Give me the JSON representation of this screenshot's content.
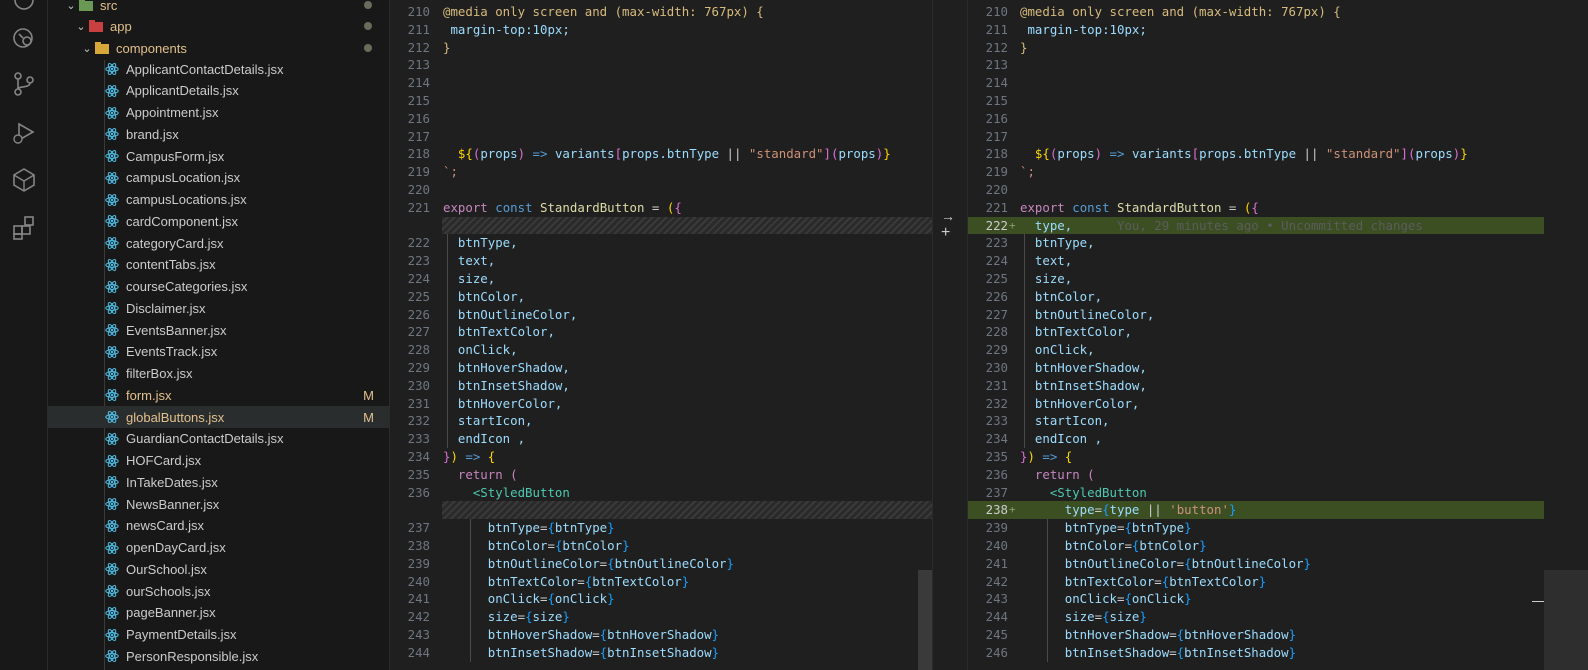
{
  "activity_bar": {
    "icons": [
      "explorer-icon",
      "remote-explorer-icon",
      "source-control-icon",
      "run-debug-icon",
      "docker-icon",
      "extensions-icon"
    ]
  },
  "explorer": {
    "folders": [
      {
        "name": "src"
      },
      {
        "name": "app"
      },
      {
        "name": "components"
      }
    ],
    "files": [
      {
        "name": "ApplicantContactDetails.jsx",
        "badge": ""
      },
      {
        "name": "ApplicantDetails.jsx",
        "badge": ""
      },
      {
        "name": "Appointment.jsx",
        "badge": ""
      },
      {
        "name": "brand.jsx",
        "badge": ""
      },
      {
        "name": "CampusForm.jsx",
        "badge": ""
      },
      {
        "name": "campusLocation.jsx",
        "badge": ""
      },
      {
        "name": "campusLocations.jsx",
        "badge": ""
      },
      {
        "name": "cardComponent.jsx",
        "badge": ""
      },
      {
        "name": "categoryCard.jsx",
        "badge": ""
      },
      {
        "name": "contentTabs.jsx",
        "badge": ""
      },
      {
        "name": "courseCategories.jsx",
        "badge": ""
      },
      {
        "name": "Disclaimer.jsx",
        "badge": ""
      },
      {
        "name": "EventsBanner.jsx",
        "badge": ""
      },
      {
        "name": "EventsTrack.jsx",
        "badge": ""
      },
      {
        "name": "filterBox.jsx",
        "badge": ""
      },
      {
        "name": "form.jsx",
        "badge": "M"
      },
      {
        "name": "globalButtons.jsx",
        "badge": "M"
      },
      {
        "name": "GuardianContactDetails.jsx",
        "badge": ""
      },
      {
        "name": "HOFCard.jsx",
        "badge": ""
      },
      {
        "name": "InTakeDates.jsx",
        "badge": ""
      },
      {
        "name": "NewsBanner.jsx",
        "badge": ""
      },
      {
        "name": "newsCard.jsx",
        "badge": ""
      },
      {
        "name": "openDayCard.jsx",
        "badge": ""
      },
      {
        "name": "OurSchool.jsx",
        "badge": ""
      },
      {
        "name": "ourSchools.jsx",
        "badge": ""
      },
      {
        "name": "pageBanner.jsx",
        "badge": ""
      },
      {
        "name": "PaymentDetails.jsx",
        "badge": ""
      },
      {
        "name": "PersonResponsible.jsx",
        "badge": ""
      }
    ]
  },
  "diff": {
    "left_numbers": [
      "210",
      "211",
      "212",
      "213",
      "214",
      "215",
      "216",
      "217",
      "218",
      "219",
      "220",
      "221",
      "222",
      "223",
      "224",
      "225",
      "226",
      "227",
      "228",
      "229",
      "230",
      "231",
      "232",
      "233",
      "234",
      "235",
      "236",
      "237",
      "238",
      "239",
      "240",
      "241",
      "242",
      "243",
      "244"
    ],
    "right_numbers": [
      "210",
      "211",
      "212",
      "213",
      "214",
      "215",
      "216",
      "217",
      "218",
      "219",
      "220",
      "221",
      "222",
      "223",
      "224",
      "225",
      "226",
      "227",
      "228",
      "229",
      "230",
      "231",
      "232",
      "233",
      "234",
      "235",
      "236",
      "237",
      "238",
      "239",
      "240",
      "241",
      "242",
      "243",
      "244",
      "245",
      "246"
    ],
    "blame": "You, 29 minutes ago • Uncommitted changes",
    "code": {
      "media": "@media only screen and (max-width: 767px) {",
      "margin": "margin-top:10px;",
      "close_brace": "}",
      "variants_line": {
        "a": "${",
        "b": "(",
        "c": "props",
        "d": ")",
        "e": " => ",
        "f": "variants",
        "g": "[",
        "h": "props.btnType",
        "i": " || ",
        "j": "\"standard\"",
        "k": "]",
        "l": "(",
        "m": "props",
        "n": ")",
        "o": "}"
      },
      "backtick": "`;",
      "export_kw": "export",
      "const_kw": "const",
      "fn_name": "StandardButton",
      "eq": " = ",
      "open": "({",
      "params": [
        "type,",
        "btnType,",
        "text,",
        "size,",
        "btnColor,",
        "btnOutlineColor,",
        "btnTextColor,",
        "onClick,",
        "btnHoverShadow,",
        "btnInsetShadow,",
        "btnHoverColor,",
        "startIcon,",
        "endIcon ,"
      ],
      "arrow_close": "}) => {",
      "return_kw": "return (",
      "styled": "StyledButton",
      "props": [
        {
          "k": "type",
          "v": "type || 'button'"
        },
        {
          "k": "btnType",
          "v": "btnType"
        },
        {
          "k": "btnColor",
          "v": "btnColor"
        },
        {
          "k": "btnOutlineColor",
          "v": "btnOutlineColor"
        },
        {
          "k": "btnTextColor",
          "v": "btnTextColor"
        },
        {
          "k": "onClick",
          "v": "onClick"
        },
        {
          "k": "size",
          "v": "size"
        },
        {
          "k": "btnHoverShadow",
          "v": "btnHoverShadow"
        },
        {
          "k": "btnInsetShadow",
          "v": "btnInsetShadow"
        }
      ]
    }
  }
}
